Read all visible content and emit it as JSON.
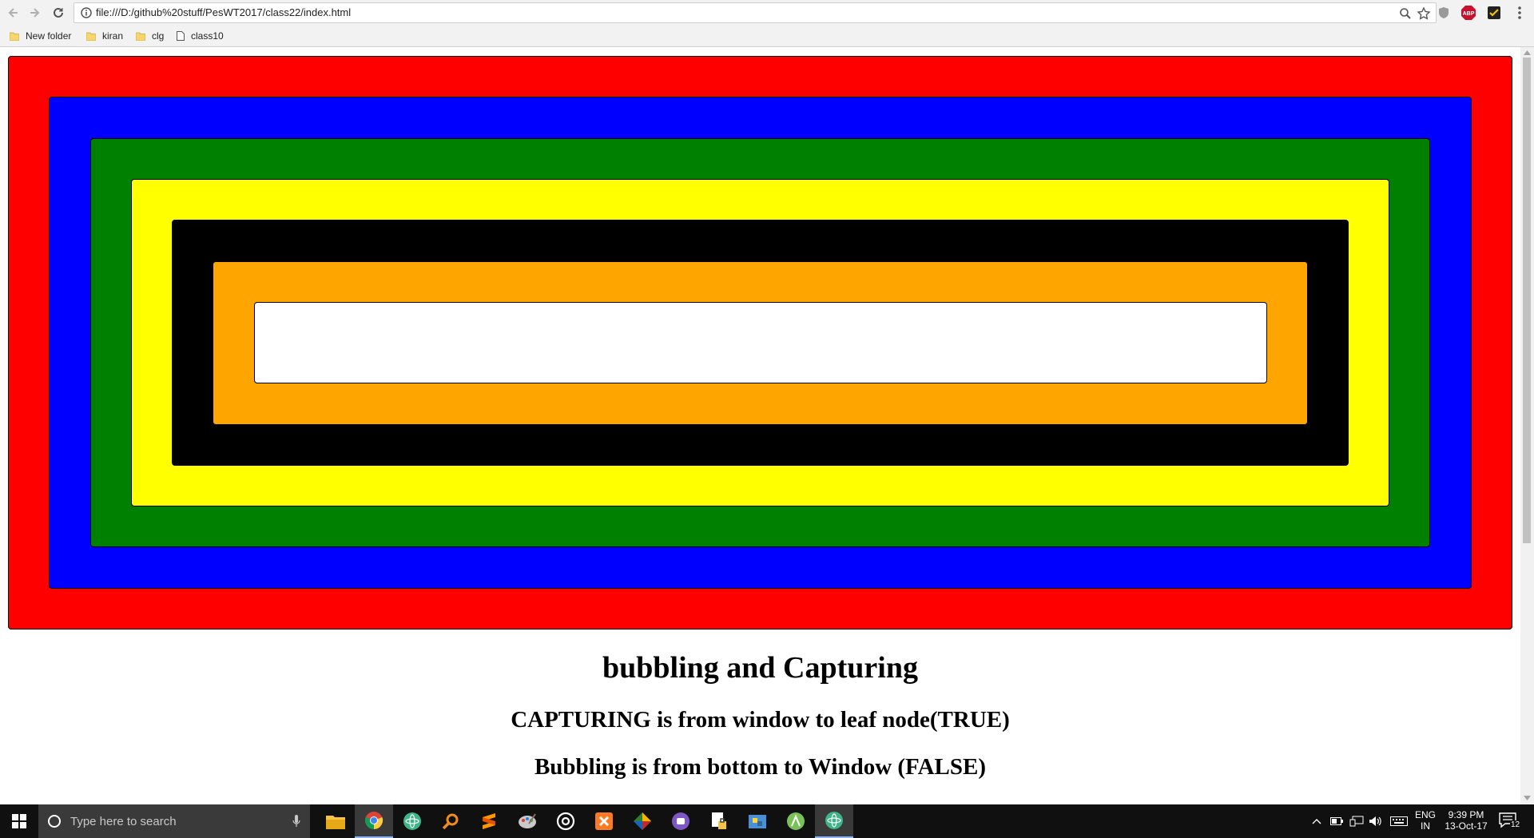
{
  "browser": {
    "url": "file:///D:/github%20stuff/PesWT2017/class22/index.html",
    "bookmarks": [
      "New folder",
      "kiran",
      "clg",
      "class10"
    ],
    "extensions": [
      "ABP"
    ]
  },
  "page": {
    "nested_boxes": [
      {
        "name": "red",
        "color": "#ff0000"
      },
      {
        "name": "blue",
        "color": "#0000ff"
      },
      {
        "name": "green",
        "color": "#008000"
      },
      {
        "name": "yellow",
        "color": "#ffff00"
      },
      {
        "name": "black",
        "color": "#000000"
      },
      {
        "name": "orange",
        "color": "#ffa500"
      },
      {
        "name": "white",
        "color": "#ffffff"
      }
    ],
    "title": "bubbling and Capturing",
    "line1": "CAPTURING is from window to leaf node(TRUE)",
    "line2": "Bubbling is from bottom to Window (FALSE)"
  },
  "taskbar": {
    "search_placeholder": "Type here to search",
    "lang": "ENG",
    "region": "IN",
    "time": "9:39 PM",
    "date": "13-Oct-17",
    "notification_count": "12"
  }
}
